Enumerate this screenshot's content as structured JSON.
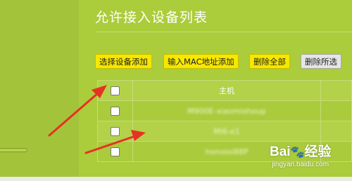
{
  "page": {
    "title": "允许接入设备列表"
  },
  "toolbar": {
    "select_add": "选择设备添加",
    "mac_add": "输入MAC地址添加",
    "delete_all": "删除全部",
    "delete_selected": "删除所选"
  },
  "table": {
    "header": {
      "host": "主机"
    },
    "rows": [
      {
        "host": "M900E-xiaomishoup"
      },
      {
        "host": "Mi6-e1"
      },
      {
        "host": "honoloi88P"
      }
    ]
  },
  "watermark": {
    "logo": "Bai",
    "logo_suffix": "经验",
    "url": "jingyan.baidu.com"
  },
  "colors": {
    "background": "#a3c43a",
    "button_yellow": "#f7e800",
    "button_gray": "#e6e6e6",
    "annotation_arrow": "#e53224"
  }
}
